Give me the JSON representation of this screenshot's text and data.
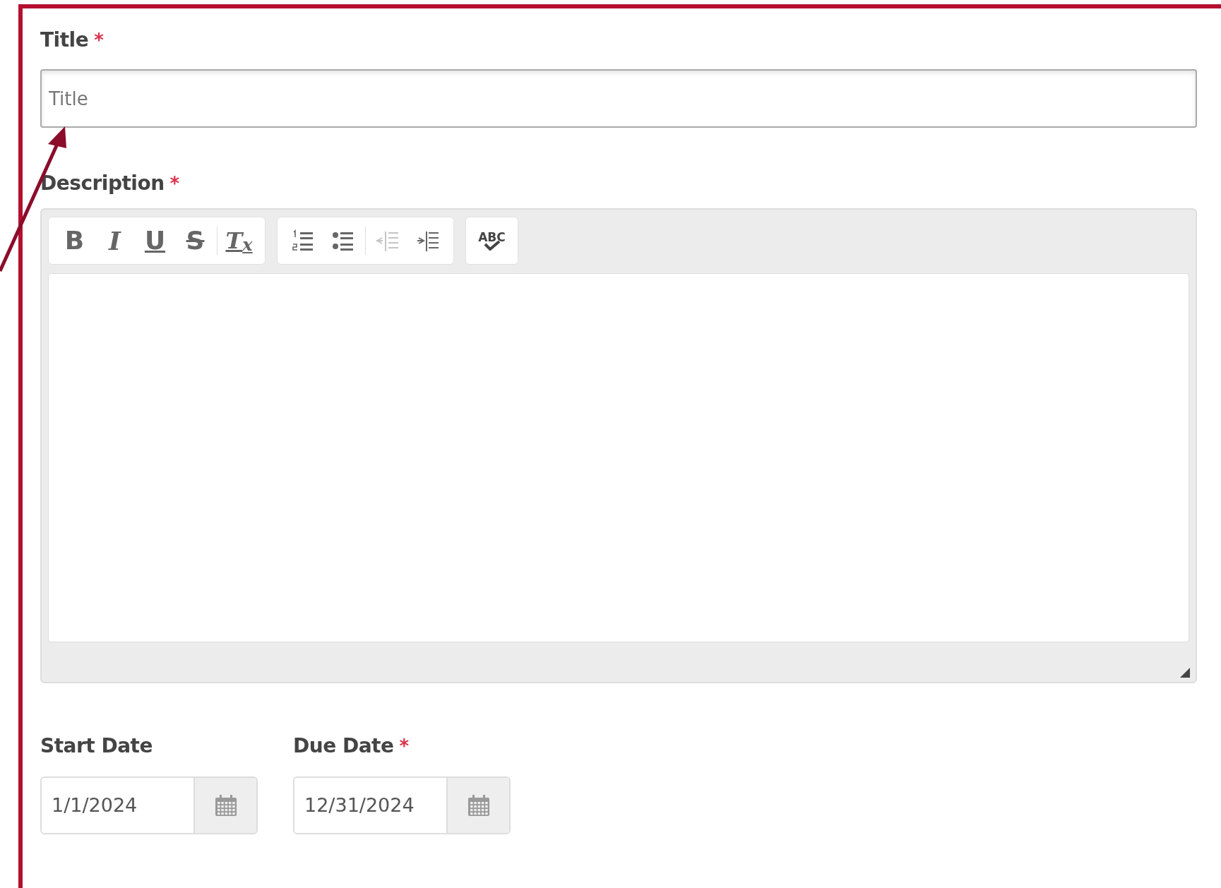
{
  "title_field": {
    "label": "Title",
    "required_mark": "*",
    "placeholder": "Title"
  },
  "description": {
    "label": "Description",
    "required_mark": "*",
    "toolbar": [
      [
        [
          {
            "kind": "bold",
            "label": "B",
            "disabled": false
          },
          {
            "kind": "italic",
            "label": "I",
            "disabled": false
          },
          {
            "kind": "underline",
            "label": "U",
            "disabled": false
          },
          {
            "kind": "strike",
            "label": "S",
            "disabled": false
          }
        ],
        [
          {
            "kind": "clear",
            "label": "T$_{x}$",
            "disabled": false
          }
        ]
      ],
      [
        [
          {
            "kind": "ordered-list",
            "disabled": false
          },
          {
            "kind": "bullet-list",
            "disabled": false
          }
        ],
        [
          {
            "kind": "outdent",
            "disabled": true
          },
          {
            "kind": "indent",
            "disabled": false
          }
        ]
      ],
      [
        [
          {
            "kind": "spellcheck",
            "label": "ABC",
            "disabled": false
          }
        ]
      ]
    ]
  },
  "date_fields": [
    {
      "label": "Start Date",
      "value": "1/1/2024"
    },
    {
      "label": "Due Date",
      "required_mark": "*",
      "value": "12/31/2024"
    }
  ]
}
